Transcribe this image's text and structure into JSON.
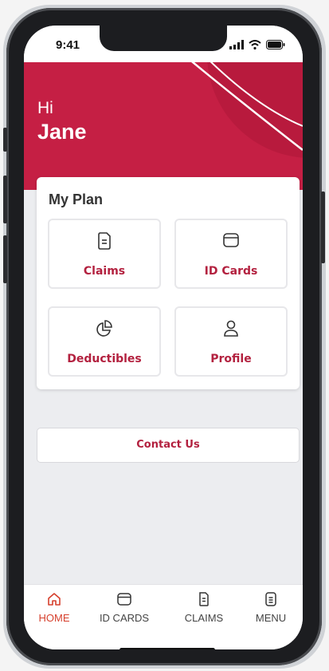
{
  "status_bar": {
    "time": "9:41",
    "icons": [
      "signal-icon",
      "wifi-icon",
      "battery-icon"
    ]
  },
  "greeting": {
    "hi": "Hi",
    "name": "Jane"
  },
  "my_plan": {
    "title": "My Plan",
    "tiles": [
      {
        "label": "Claims",
        "icon": "claims-icon"
      },
      {
        "label": "ID Cards",
        "icon": "id-card-icon"
      },
      {
        "label": "Deductibles",
        "icon": "pie-chart-icon"
      },
      {
        "label": "Profile",
        "icon": "person-icon"
      }
    ]
  },
  "contact_us": {
    "label": "Contact Us"
  },
  "tab_bar": {
    "tabs": [
      {
        "label": "HOME",
        "icon": "home-icon",
        "active": true
      },
      {
        "label": "ID CARDS",
        "icon": "id-card-icon",
        "active": false
      },
      {
        "label": "CLAIMS",
        "icon": "claims-icon",
        "active": false
      },
      {
        "label": "MENU",
        "icon": "menu-icon",
        "active": false
      }
    ]
  },
  "colors": {
    "brand_red": "#c51f44",
    "label_red": "#b3213f",
    "active_tab": "#d6402d"
  }
}
